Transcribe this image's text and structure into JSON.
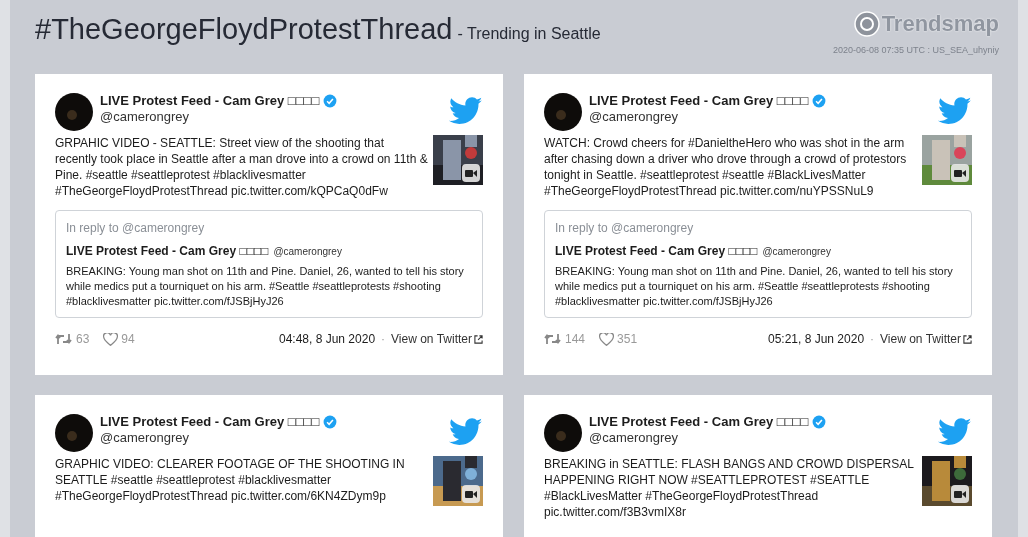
{
  "header": {
    "title": "#TheGeorgeFloydProtestThread",
    "subtitle": "- Trending in Seattle",
    "logo": "Trendsmap",
    "timestamp": "2020-06-08 07:35 UTC : US_SEA_uhyniy"
  },
  "tweets": [
    {
      "name": "LIVE Protest Feed - Cam Grey □□□□",
      "verified": true,
      "handle": "@camerongrey",
      "text": "GRPAHIC VIDEO - SEATTLE: Street view of the shooting that recently took place in Seattle after a man drove into a crowd on 11th & Pine. #seattle #seattleprotest #blacklivesmatter #TheGeorgeFloydProtestThread pic.twitter.com/kQPCaQ0dFw",
      "reply": {
        "label": "In reply to @camerongrey",
        "name": "LIVE Protest Feed - Cam Grey □□□□",
        "handle": "@camerongrey",
        "text": "BREAKING: Young man shot on 11th and Pine. Daniel, 26, wanted to tell his story while medics put a tourniquet on his arm. #Seattle #seattleprotests #shooting #blacklivesmatter pic.twitter.com/fJSBjHyJ26"
      },
      "retweets": "63",
      "likes": "94",
      "time": "04:48, 8 Jun 2020",
      "separator": "·",
      "link": "View on Twitter"
    },
    {
      "name": "LIVE Protest Feed - Cam Grey □□□□",
      "verified": true,
      "handle": "@camerongrey",
      "text": "WATCH: Crowd cheers for #DanieltheHero who was shot in the arm after chasing down a driver who drove through a crowd of protestors tonight in Seattle. #seattleprotest #seattle #BlackLivesMatter #TheGeorgeFloydProtestThread pic.twitter.com/nuYPSSNuL9",
      "reply": {
        "label": "In reply to @camerongrey",
        "name": "LIVE Protest Feed - Cam Grey □□□□",
        "handle": "@camerongrey",
        "text": "BREAKING: Young man shot on 11th and Pine. Daniel, 26, wanted to tell his story while medics put a tourniquet on his arm. #Seattle #seattleprotests #shooting #blacklivesmatter pic.twitter.com/fJSBjHyJ26"
      },
      "retweets": "144",
      "likes": "351",
      "time": "05:21, 8 Jun 2020",
      "separator": "·",
      "link": "View on Twitter"
    },
    {
      "name": "LIVE Protest Feed - Cam Grey □□□□",
      "verified": true,
      "handle": "@camerongrey",
      "text": "GRAPHIC VIDEO: CLEARER FOOTAGE OF THE SHOOTING IN SEATTLE #seattle #seattleprotest #blacklivesmatter #TheGeorgeFloydProtestThread pic.twitter.com/6KN4ZDym9p"
    },
    {
      "name": "LIVE Protest Feed - Cam Grey □□□□",
      "verified": true,
      "handle": "@camerongrey",
      "text": "BREAKING in SEATTLE: FLASH BANGS AND CROWD DISPERSAL HAPPENING RIGHT NOW #SEATTLEPROTEST #SEATTLE #BlackLivesMatter #TheGeorgeFloydProtestThread pic.twitter.com/f3B3vmIX8r"
    }
  ]
}
